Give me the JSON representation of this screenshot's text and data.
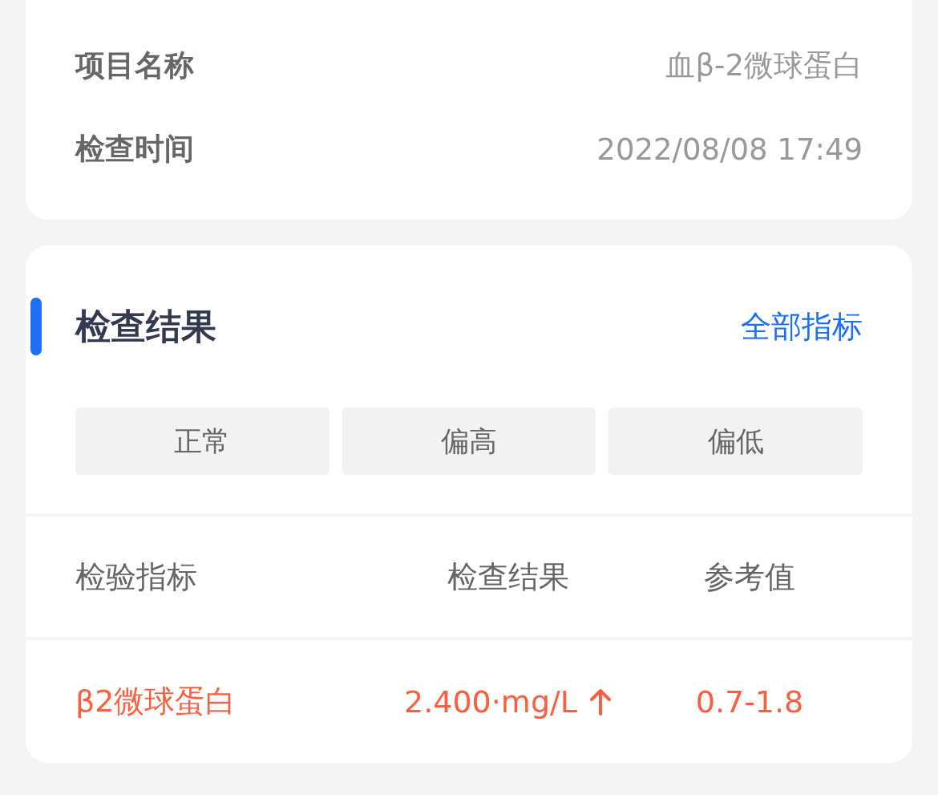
{
  "info": [
    {
      "label": "项目名称",
      "value": "血β-2微球蛋白"
    },
    {
      "label": "检查时间",
      "value": "2022/08/08 17:49"
    }
  ],
  "results": {
    "title": "检查结果",
    "link": "全部指标",
    "filters": [
      {
        "label": "正常",
        "selected": false
      },
      {
        "label": "偏高",
        "selected": false
      },
      {
        "label": "偏低",
        "selected": false
      }
    ],
    "columns": [
      "检验指标",
      "检查结果",
      "参考值"
    ],
    "rows": [
      {
        "kind": "high",
        "name": "β2微球蛋白",
        "result": "2.400·mg/L",
        "reference": "0.7-1.8"
      }
    ]
  }
}
